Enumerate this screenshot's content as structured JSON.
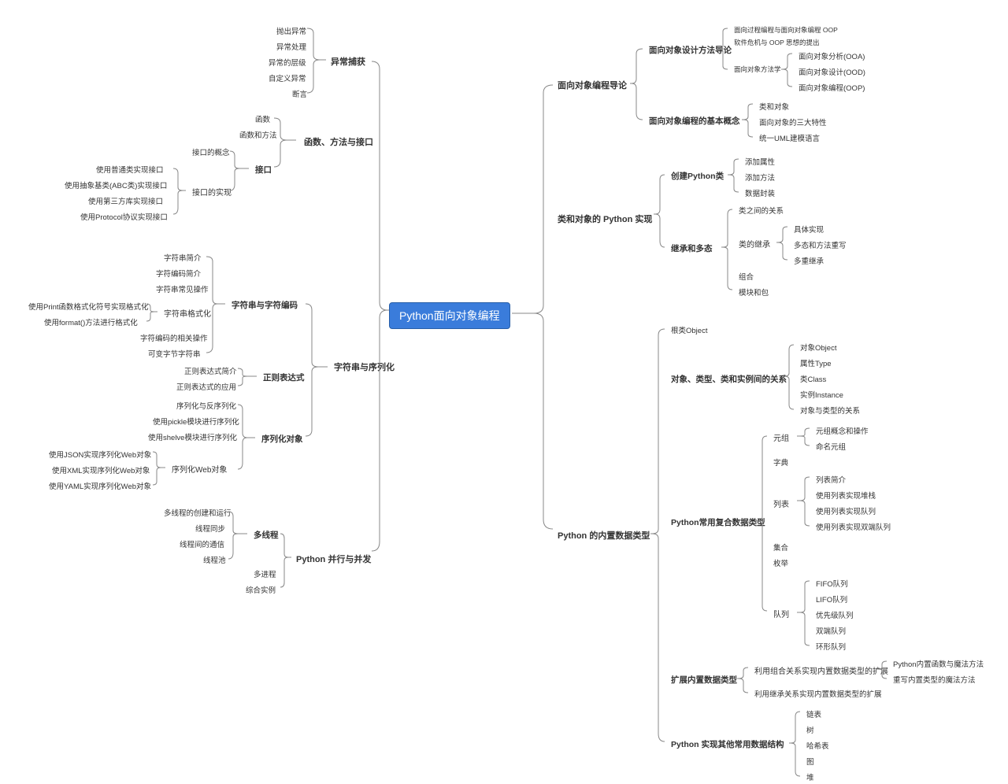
{
  "root": "Python面向对象编程",
  "left": {
    "b1": {
      "title": "异常捕获",
      "items": [
        "抛出异常",
        "异常处理",
        "异常的层级",
        "自定义异常",
        "断言"
      ]
    },
    "b2": {
      "title": "函数、方法与接口",
      "c1": "函数",
      "c2": "函数和方法",
      "c3": {
        "title": "接口",
        "d1": "接口的概念",
        "d2": {
          "title": "接口的实现",
          "items": [
            "使用普通类实现接口",
            "使用抽象基类(ABC类)实现接口",
            "使用第三方库实现接口",
            "使用Protocol协议实现接口"
          ]
        }
      }
    },
    "b3": {
      "title": "字符串与序列化",
      "c1": {
        "title": "字符串与字符编码",
        "d1": "字符串简介",
        "d2": "字符编码简介",
        "d3": "字符串常见操作",
        "d4": {
          "title": "字符串格式化",
          "items": [
            "使用Print函数格式化符号实现格式化",
            "使用format()方法进行格式化"
          ]
        },
        "d5": "字符编码的相关操作",
        "d6": "可变字节字符串"
      },
      "c2": {
        "title": "正则表达式",
        "items": [
          "正则表达式简介",
          "正则表达式的应用"
        ]
      },
      "c3": {
        "title": "序列化对象",
        "d1": "序列化与反序列化",
        "d2": "使用pickle模块进行序列化",
        "d3": "使用shelve模块进行序列化",
        "d4": {
          "title": "序列化Web对象",
          "items": [
            "使用JSON实现序列化Web对象",
            "使用XML实现序列化Web对象",
            "使用YAML实现序列化Web对象"
          ]
        }
      }
    },
    "b4": {
      "title": "Python 并行与并发",
      "c1": {
        "title": "多线程",
        "items": [
          "多线程的创建和运行",
          "线程同步",
          "线程间的通信",
          "线程池"
        ]
      },
      "c2": "多进程",
      "c3": "综合实例"
    }
  },
  "right": {
    "b1": {
      "title": "面向对象编程导论",
      "c1": {
        "title": "面向对象设计方法导论",
        "d1": "面向过程编程与面向对象编程 OOP",
        "d2": "软件危机与 OOP 思想的提出",
        "d3": {
          "title": "面向对象方法学",
          "items": [
            "面向对象分析(OOA)",
            "面向对象设计(OOD)",
            "面向对象编程(OOP)"
          ]
        }
      },
      "c2": {
        "title": "面向对象编程的基本概念",
        "items": [
          "类和对象",
          "面向对象的三大特性",
          "统一UML建模语言"
        ]
      }
    },
    "b2": {
      "title": "类和对象的 Python 实现",
      "c1": {
        "title": "创建Python类",
        "items": [
          "添加属性",
          "添加方法",
          "数据封装"
        ]
      },
      "c2": {
        "title": "继承和多态",
        "d1": "类之间的关系",
        "d2": {
          "title": "类的继承",
          "items": [
            "具体实现",
            "多态和方法重写",
            "多重继承"
          ]
        },
        "d3": "组合",
        "d4": "模块和包"
      }
    },
    "b3": {
      "title": "Python 的内置数据类型",
      "c1": "根类Object",
      "c2": {
        "title": "对象、类型、类和实例间的关系",
        "items": [
          "对象Object",
          "属性Type",
          "类Class",
          "实例Instance",
          "对象与类型的关系"
        ]
      },
      "c3": {
        "title": "Python常用复合数据类型",
        "d1": {
          "title": "元组",
          "items": [
            "元组概念和操作",
            "命名元组"
          ]
        },
        "d2": "字典",
        "d3": {
          "title": "列表",
          "items": [
            "列表简介",
            "使用列表实现堆栈",
            "使用列表实现队列",
            "使用列表实现双端队列"
          ]
        },
        "d4": "集合",
        "d5": "枚举",
        "d6": {
          "title": "队列",
          "items": [
            "FIFO队列",
            "LIFO队列",
            "优先级队列",
            "双端队列",
            "环形队列"
          ]
        }
      },
      "c4": {
        "title": "扩展内置数据类型",
        "d1": {
          "title": "利用组合关系实现内置数据类型的扩展",
          "items": [
            "Python内置函数与魔法方法",
            "重写内置类型的魔法方法"
          ]
        },
        "d2": "利用继承关系实现内置数据类型的扩展"
      },
      "c5": {
        "title": "Python 实现其他常用数据结构",
        "items": [
          "链表",
          "树",
          "哈希表",
          "图",
          "堆"
        ]
      }
    }
  }
}
